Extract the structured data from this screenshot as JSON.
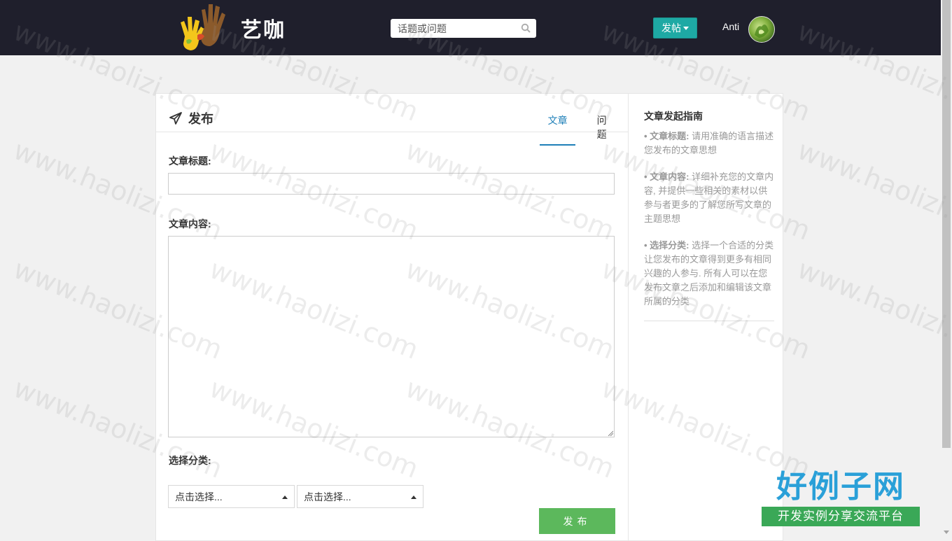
{
  "header": {
    "logo_text": "艺咖",
    "search_placeholder": "话题或问题",
    "post_button": "发帖",
    "username": "Anti"
  },
  "publish": {
    "title": "发布",
    "tabs": [
      {
        "label": "文章",
        "active": true
      },
      {
        "label": "问题",
        "active": false
      }
    ],
    "title_label": "文章标题:",
    "title_value": "",
    "content_label": "文章内容:",
    "content_value": "",
    "category_label": "选择分类:",
    "selects": [
      {
        "label": "点击选择..."
      },
      {
        "label": "点击选择..."
      }
    ],
    "submit_label": "发布"
  },
  "guide": {
    "title": "文章发起指南",
    "items": [
      {
        "head": "• 文章标题:",
        "text": "请用准确的语言描述您发布的文章思想"
      },
      {
        "head": "• 文章内容:",
        "text": "详细补充您的文章内容, 并提供一些相关的素材以供参与者更多的了解您所写文章的主题思想"
      },
      {
        "head": "• 选择分类:",
        "text": "选择一个合适的分类让您发布的文章得到更多有相同兴趣的人参与. 所有人可以在您发布文章之后添加和编辑该文章所属的分类"
      }
    ]
  },
  "watermark": {
    "text": "www.haolizi.com",
    "brand_big": "好例子网",
    "brand_small": "开发实例分享交流平台"
  },
  "colors": {
    "header_bg": "#1f1f2c",
    "accent_teal": "#1ea9a4",
    "tab_active": "#1e7fb8",
    "submit_green": "#5cb85c"
  }
}
